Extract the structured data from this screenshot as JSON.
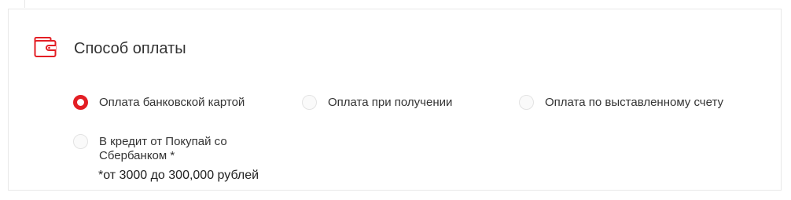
{
  "section": {
    "title": "Способ оплаты",
    "icon": "wallet-icon",
    "accent_color": "#e31e24"
  },
  "payment_options": [
    {
      "label": "Оплата банковской картой",
      "checked": true
    },
    {
      "label": "Оплата при получении",
      "checked": false
    },
    {
      "label": "Оплата по выставленному счету",
      "checked": false
    },
    {
      "label": "В кредит от Покупай со Сбербанком *",
      "checked": false
    }
  ],
  "credit_note": "*от 3000 до 300,000 рублей"
}
